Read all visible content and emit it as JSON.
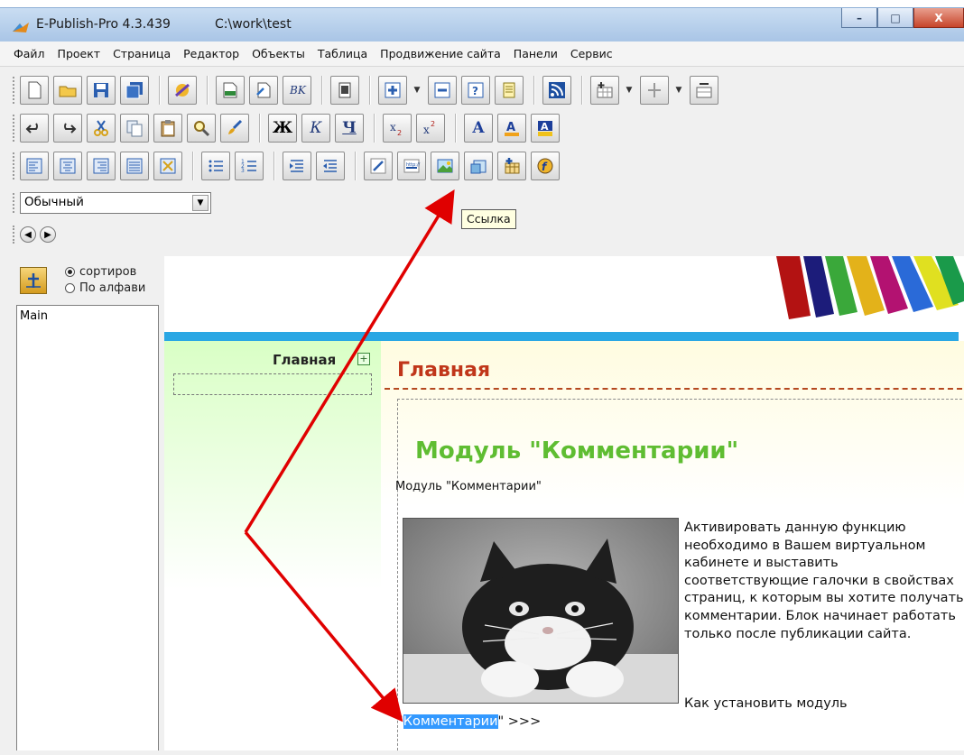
{
  "window": {
    "title": "E-Publish-Pro 4.3.439",
    "path": "C:\\work\\test",
    "minimize_glyph": "–",
    "maximize_glyph": "□",
    "close_glyph": "X"
  },
  "menu": [
    "Файл",
    "Проект",
    "Страница",
    "Редактор",
    "Объекты",
    "Таблица",
    "Продвижение сайта",
    "Панели",
    "Сервис"
  ],
  "toolbar": {
    "bold_glyph": "Ж",
    "italic_glyph": "К",
    "underline_glyph": "Ч",
    "font_a_glyph": "A",
    "style_value": "Обычный",
    "tooltip": "Ссылка"
  },
  "left_panel": {
    "radio_sort": "сортиров",
    "radio_alpha": "По алфави",
    "tree_items": [
      "Main"
    ]
  },
  "page": {
    "nav_item": "Главная",
    "plus_glyph": "+",
    "title": "Главная",
    "module_heading": "Модуль \"Комментарии\"",
    "module_sub": "Модуль \"Комментарии\"",
    "description": "Активировать данную функцию необходимо в Вашем виртуальном кабинете и выставить соответствующие галочки в свойствах страниц, к которым вы хотите получать комментарии. Блок начинает работать только после публикации сайта.",
    "install_link": "Как установить модуль",
    "link_prefix": "\"",
    "link_selected": "Комментарии",
    "link_suffix": "\" >>>"
  },
  "colors": {
    "accent_blue": "#2aa7e4",
    "title_red": "#c0361a",
    "module_green": "#5fbd32",
    "arrow_red": "#e00000"
  }
}
